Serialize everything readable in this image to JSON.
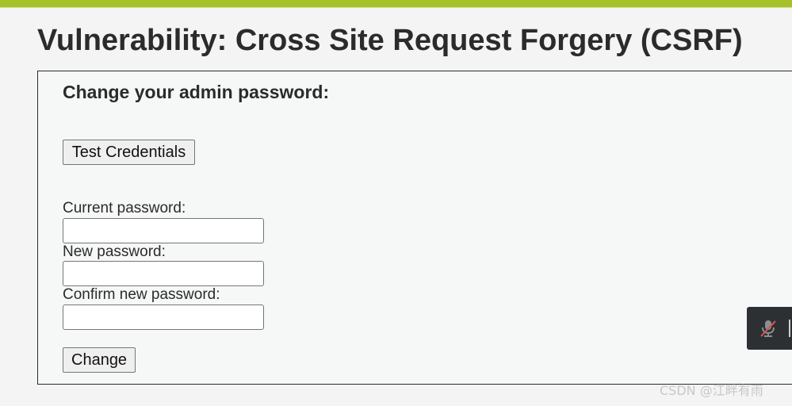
{
  "page": {
    "title": "Vulnerability: Cross Site Request Forgery (CSRF)"
  },
  "form": {
    "heading": "Change your admin password:",
    "test_button_label": "Test Credentials",
    "current_password_label": "Current password:",
    "current_password_value": "",
    "new_password_label": "New password:",
    "new_password_value": "",
    "confirm_password_label": "Confirm new password:",
    "confirm_password_value": "",
    "change_button_label": "Change"
  },
  "overlay": {
    "mic_icon": "mic-muted-icon"
  },
  "watermark": {
    "text": "CSDN @江畔有雨"
  },
  "colors": {
    "accent_stripe": "#a5c22b",
    "panel_background": "#f6f7f7",
    "page_background": "#f4f4f4",
    "text": "#2b2b2b",
    "mic_widget_background": "#2d3033",
    "mic_muted_slash": "#d9534f"
  }
}
